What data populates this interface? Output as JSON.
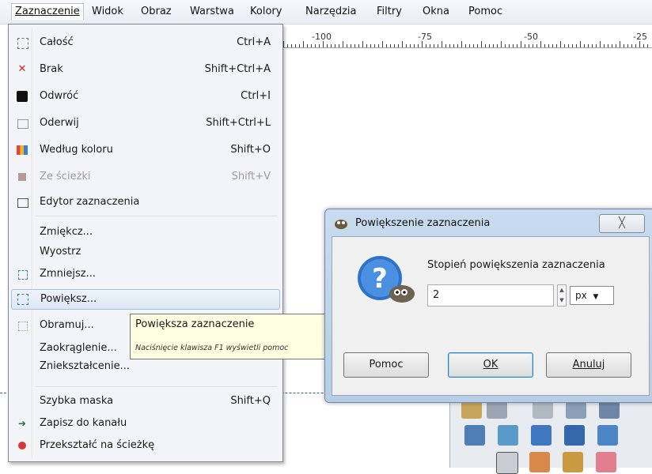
{
  "menubar": {
    "items": [
      {
        "label": "Zaznaczenie",
        "key": "Z"
      },
      {
        "label": "Widok",
        "key": "W"
      },
      {
        "label": "Obraz",
        "key": "b"
      },
      {
        "label": "Warstwa",
        "key": "a"
      },
      {
        "label": "Kolory",
        "key": "K"
      },
      {
        "label": "Narzędzia",
        "key": "N"
      },
      {
        "label": "Filtry",
        "key": "F"
      },
      {
        "label": "Okna",
        "key": "O"
      },
      {
        "label": "Pomoc",
        "key": "c"
      }
    ]
  },
  "ruler": {
    "labels": [
      "-100",
      "-75",
      "-50",
      "-25"
    ]
  },
  "menu": {
    "items": [
      {
        "label": "Całość",
        "accel": "Ctrl+A",
        "icon": "select-all-icon"
      },
      {
        "label": "Brak",
        "accel": "Shift+Ctrl+A",
        "icon": "select-none-icon"
      },
      {
        "label": "Odwróć",
        "accel": "Ctrl+I",
        "icon": "invert-icon"
      },
      {
        "label": "Oderwij",
        "accel": "Shift+Ctrl+L",
        "icon": "float-icon"
      },
      {
        "label": "Według koloru",
        "accel": "Shift+O",
        "icon": "by-color-icon"
      },
      {
        "label": "Ze ścieżki",
        "accel": "Shift+V",
        "icon": "from-path-icon"
      },
      {
        "label": "Edytor zaznaczenia",
        "accel": "",
        "icon": "selection-editor-icon"
      },
      {
        "label": "Zmiękcz...",
        "accel": "",
        "icon": ""
      },
      {
        "label": "Wyostrz",
        "accel": "",
        "icon": ""
      },
      {
        "label": "Zmniejsz...",
        "accel": "",
        "icon": "shrink-icon"
      },
      {
        "label": "Powiększ...",
        "accel": "",
        "icon": "grow-icon"
      },
      {
        "label": "Obramuj...",
        "accel": "",
        "icon": "border-icon"
      },
      {
        "label": "Zaokrąglenie...",
        "accel": "",
        "icon": ""
      },
      {
        "label": "Zniekształcenie...",
        "accel": "",
        "icon": ""
      },
      {
        "label": "Szybka maska",
        "accel": "Shift+Q",
        "icon": "quick-mask-icon"
      },
      {
        "label": "Zapisz do kanału",
        "accel": "",
        "icon": "save-to-channel-icon"
      },
      {
        "label": "Przekształć na ścieżkę",
        "accel": "",
        "icon": "to-path-icon"
      }
    ]
  },
  "tooltip": {
    "title": "Powiększa zaznaczenie",
    "hint": "Naciśnięcie klawisza F1 wyświetli pomoc"
  },
  "dialog": {
    "title": "Powiększenie zaznaczenia",
    "close_glyph": "╳",
    "prompt": "Stopień powiększenia zaznaczenia",
    "value": "2",
    "unit": "px",
    "buttons": {
      "help": "Pomoc",
      "ok": "OK",
      "cancel": "Anuluj"
    }
  },
  "colors": {
    "accent": "#3c7fb1",
    "highlight": "#dde8f4",
    "tooltip": "#ffffe1"
  }
}
